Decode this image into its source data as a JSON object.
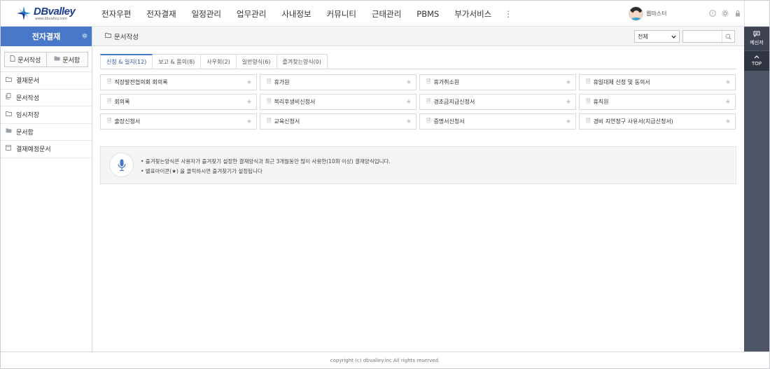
{
  "logo": {
    "name": "DBvalley",
    "url": "www.dbvalley.com"
  },
  "gnb": [
    "전자우편",
    "전자결재",
    "일정관리",
    "업무관리",
    "사내정보",
    "커뮤니티",
    "근태관리",
    "PBMS",
    "부가서비스"
  ],
  "gnb_more": "⋮",
  "user": {
    "name": "웹마스터"
  },
  "rail": {
    "messenger": "메신저",
    "top": "TOP"
  },
  "sidebar": {
    "title": "전자결재",
    "write_button": "문서작성",
    "box_button": "문서함",
    "items": [
      "결재문서",
      "문서작성",
      "임시저장",
      "문서함",
      "결재예정문서"
    ]
  },
  "main": {
    "title": "문서작성",
    "search_select": "전체",
    "tabs": [
      "신청 & 일지(12)",
      "보고 & 품의(8)",
      "사우회(2)",
      "일반양식(6)",
      "즐겨찾는양식(0)"
    ],
    "forms": [
      "직장발전협의회 회의록",
      "휴가원",
      "휴가취소원",
      "휴일대체 신청 및 동의서",
      "회의록",
      "복리후생비신청서",
      "경조금지급신청서",
      "휴직원",
      "출장신청서",
      "교육신청서",
      "증명서신청서",
      "경비 지연청구 사유서(지급신청서)"
    ],
    "notice": [
      "• 즐겨찾는양식은 사용자가 즐겨찾기 설정한 결재양식과 최근 3개월동안 많이 사용한(10회 이상) 결재양식입니다.",
      "• 별표아이콘(★) 을 클릭하시면 즐겨찾기가 설정됩니다"
    ]
  },
  "footer": "copyright (c) dbvalley.inc All rights reserved.",
  "colors": {
    "accent": "#4a78c8",
    "rail": "#4e5566"
  }
}
